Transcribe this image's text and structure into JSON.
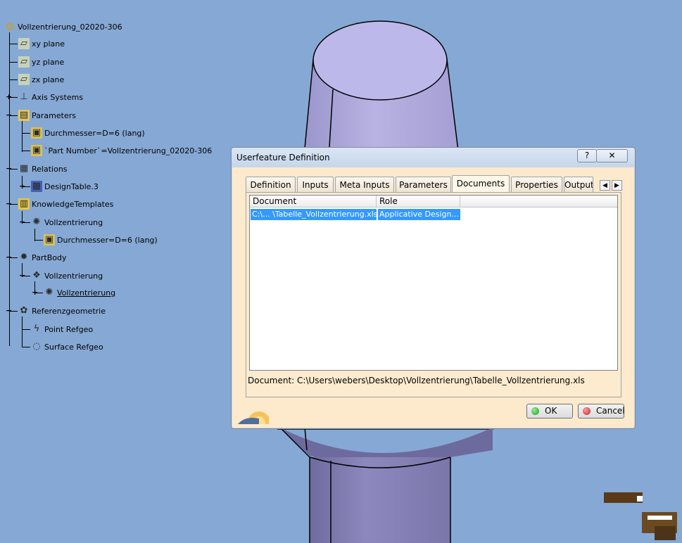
{
  "tree": {
    "root": "Vollzentrierung_02020-306",
    "items": [
      {
        "label": "xy plane",
        "icon": "plane-icon"
      },
      {
        "label": "yz plane",
        "icon": "plane-icon"
      },
      {
        "label": "zx plane",
        "icon": "plane-icon"
      },
      {
        "label": "Axis Systems",
        "icon": "axis-system-icon"
      },
      {
        "label": "Parameters",
        "icon": "parameters-icon"
      },
      {
        "label": "Durchmesser=D=6 (lang)",
        "icon": "parameter-icon"
      },
      {
        "label": "`Part Number`=Vollzentrierung_02020-306",
        "icon": "parameter-icon"
      },
      {
        "label": "Relations",
        "icon": "relations-icon"
      },
      {
        "label": "DesignTable.3",
        "icon": "design-table-icon"
      },
      {
        "label": "KnowledgeTemplates",
        "icon": "knowledge-templates-icon"
      },
      {
        "label": "Vollzentrierung",
        "icon": "userfeature-icon"
      },
      {
        "label": "Durchmesser=D=6 (lang)",
        "icon": "parameter-icon"
      },
      {
        "label": "PartBody",
        "icon": "partbody-icon"
      },
      {
        "label": "Vollzentrierung",
        "icon": "feature-set-icon"
      },
      {
        "label": "Vollzentrierung",
        "icon": "userfeature-icon"
      },
      {
        "label": "Referenzgeometrie",
        "icon": "geometrical-set-icon"
      },
      {
        "label": "Point Refgeo",
        "icon": "point-icon"
      },
      {
        "label": "Surface Refgeo",
        "icon": "surface-icon"
      }
    ]
  },
  "dialog": {
    "title": "Userfeature Definition",
    "help": "?",
    "close": "✕",
    "tabs": [
      "Definition",
      "Inputs",
      "Meta Inputs",
      "Parameters",
      "Documents",
      "Properties",
      "Output"
    ],
    "active_tab": "Documents",
    "columns": [
      "Document",
      "Role"
    ],
    "rows": [
      {
        "document": "C:\\... \\Tabelle_Vollzentrierung.xls",
        "role": "Applicative Design..."
      }
    ],
    "status": "Document: C:\\Users\\webers\\Desktop\\Vollzentrierung\\Tabelle_Vollzentrierung.xls",
    "ok": "OK",
    "cancel": "Cancel"
  },
  "colors": {
    "background": "#86a8d4",
    "part": "#a9a3d6",
    "dialog_bg": "#fde9cc",
    "selection": "#3399ff",
    "ok_dot": "#1aa01a",
    "cancel_dot": "#d02020"
  }
}
